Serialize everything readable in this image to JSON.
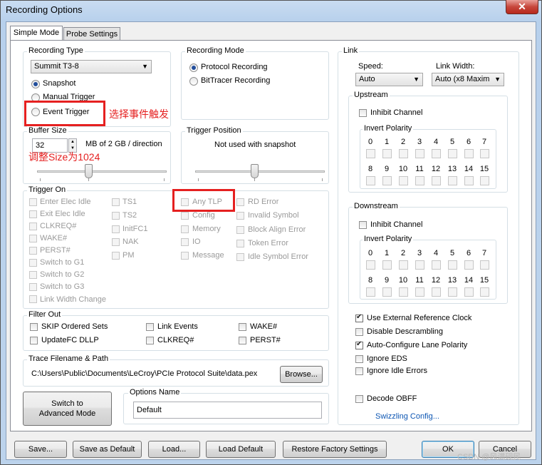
{
  "window": {
    "title": "Recording Options",
    "close": "✕"
  },
  "tabs": [
    "Simple Mode",
    "Probe Settings"
  ],
  "recording_type": {
    "label": "Recording Type",
    "combo": "Summit T3-8",
    "options": [
      "Snapshot",
      "Manual Trigger",
      "Event Trigger"
    ]
  },
  "recording_mode": {
    "label": "Recording Mode",
    "options": [
      "Protocol Recording",
      "BitTracer Recording"
    ]
  },
  "buffer_size": {
    "label": "Buffer Size",
    "value": "32",
    "suffix": "MB of 2 GB / direction"
  },
  "trigger_position": {
    "label": "Trigger Position",
    "text": "Not used with snapshot"
  },
  "annotations": {
    "event_trigger": "选择事件触发",
    "size": "调整Size为1024"
  },
  "trigger_on": {
    "label": "Trigger On",
    "col1": [
      "Enter Elec Idle",
      "Exit Elec Idle",
      "CLKREQ#",
      "WAKE#",
      "PERST#",
      "Switch to G1",
      "Switch to G2",
      "Switch to G3",
      "Link Width Change"
    ],
    "col2": [
      "TS1",
      "TS2",
      "InitFC1",
      "NAK",
      "PM"
    ],
    "col3": [
      "Any TLP",
      "Config",
      "Memory",
      "IO",
      "Message"
    ],
    "col4": [
      "RD Error",
      "Invalid Symbol",
      "Block Align Error",
      "Token Error",
      "Idle Symbol Error"
    ]
  },
  "filter_out": {
    "label": "Filter Out",
    "items": [
      "SKIP Ordered Sets",
      "UpdateFC DLLP",
      "Link Events",
      "CLKREQ#",
      "WAKE#",
      "PERST#"
    ]
  },
  "trace": {
    "label": "Trace Filename & Path",
    "path": "C:\\Users\\Public\\Documents\\LeCroy\\PCIe Protocol Suite\\data.pex",
    "browse": "Browse..."
  },
  "switch_button": {
    "line1": "Switch to",
    "line2": "Advanced Mode"
  },
  "options_name": {
    "label": "Options Name",
    "value": "Default"
  },
  "link": {
    "label": "Link",
    "speed_label": "Speed:",
    "speed_value": "Auto",
    "width_label": "Link Width:",
    "width_value": "Auto (x8 Maxim",
    "upstream": "Upstream",
    "downstream": "Downstream",
    "inhibit": "Inhibit Channel",
    "invert": "Invert Polarity",
    "bits_row1": [
      "0",
      "1",
      "2",
      "3",
      "4",
      "5",
      "6",
      "7"
    ],
    "bits_row2": [
      "8",
      "9",
      "10",
      "11",
      "12",
      "13",
      "14",
      "15"
    ],
    "options": [
      "Use External Reference Clock",
      "Disable Descrambling",
      "Auto-Configure Lane Polarity",
      "Ignore EDS",
      "Ignore Idle Errors"
    ],
    "decode": "Decode OBFF",
    "swizzling": "Swizzling Config..."
  },
  "bottom_buttons": [
    "Save...",
    "Save as Default",
    "Load...",
    "Load Default",
    "Restore Factory Settings",
    "OK",
    "Cancel"
  ],
  "watermark": "CSDN @风满砚民"
}
